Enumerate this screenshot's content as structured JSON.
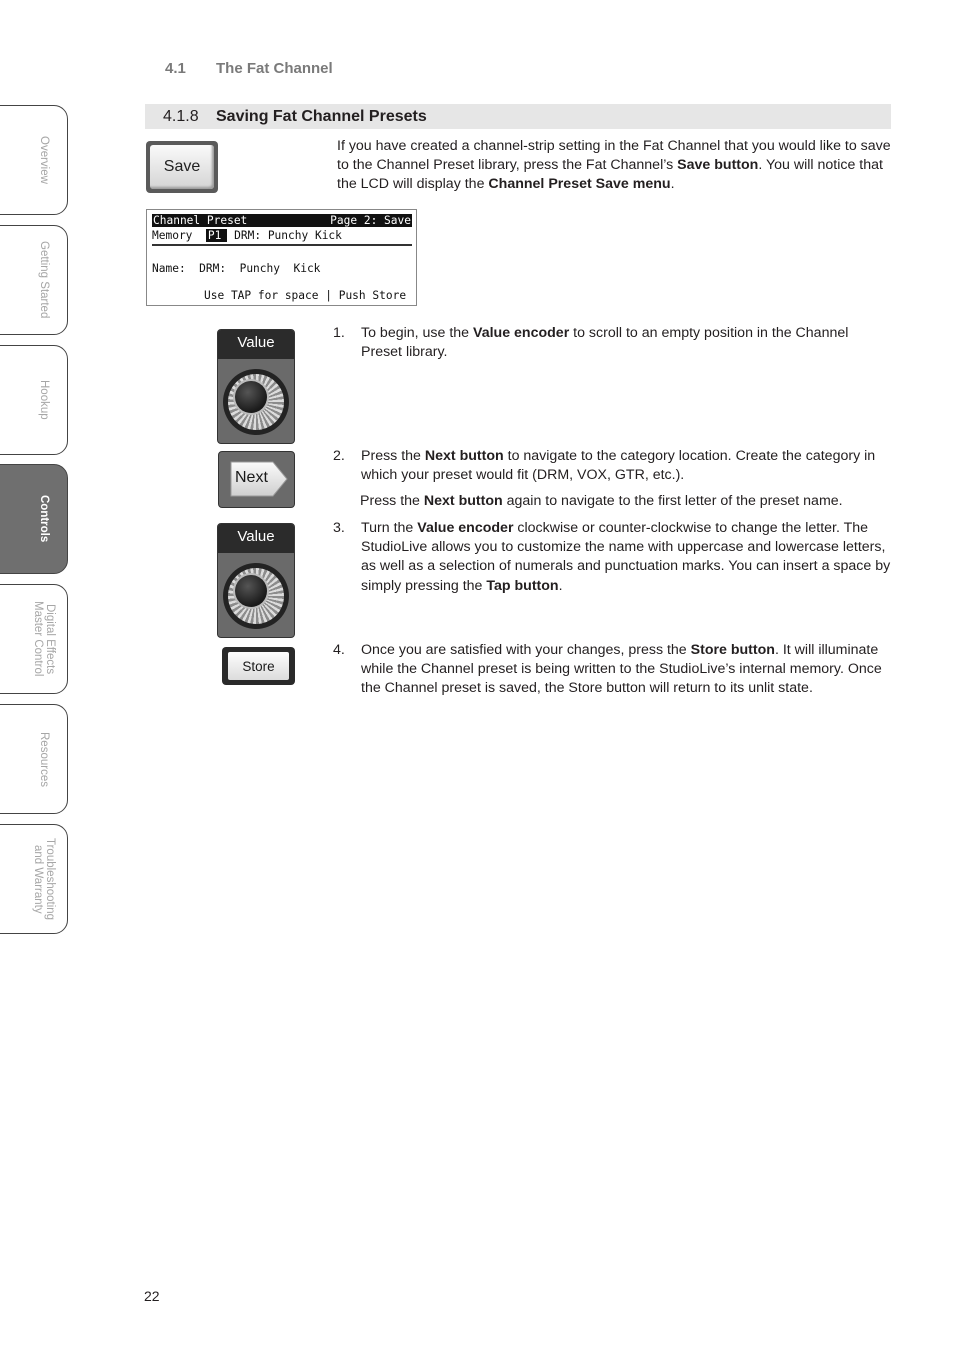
{
  "side_tabs": [
    {
      "label": "Overview",
      "active": false
    },
    {
      "label": "Getting Started",
      "active": false
    },
    {
      "label": "Hookup",
      "active": false
    },
    {
      "label": "Controls",
      "active": true
    },
    {
      "label": "Digital Effects\nMaster Control",
      "active": false
    },
    {
      "label": "Resources",
      "active": false
    },
    {
      "label": "Troubleshooting\nand Warranty",
      "active": false
    }
  ],
  "section": {
    "number": "4.1",
    "title": "The Fat Channel"
  },
  "subsection": {
    "number": "4.1.8",
    "title": "Saving Fat Channel Presets"
  },
  "save_button_label": "Save",
  "intro": {
    "part1": "If you have created a channel-strip setting in the Fat Channel that you would like to save to the Channel Preset library, press the Fat Channel’s ",
    "bold1": "Save button",
    "part2": ". You will notice that the LCD will display the ",
    "bold2": "Channel Preset Save menu",
    "part3": "."
  },
  "lcd": {
    "title_left": "Channel Preset",
    "title_right": "Page 2: Save",
    "memory_label": "Memory",
    "memory_slot": "P1",
    "memory_name": "DRM: Punchy Kick",
    "name_label": "Name:",
    "name_value": "DRM:  Punchy  Kick",
    "hint": "Use TAP for space | Push Store"
  },
  "controls": {
    "encoder_label": "Value",
    "next_label": "Next",
    "store_label": "Store"
  },
  "steps": [
    {
      "n": "1.",
      "pre": "To begin, use the ",
      "bold": "Value encoder",
      "post": " to scroll to an empty position in the Channel Preset library."
    },
    {
      "n": "2.",
      "pre": "Press the ",
      "bold": "Next button",
      "post": " to navigate to the category location. Create the category in which your preset would fit (DRM, VOX, GTR, etc.)."
    },
    {
      "n": "3.",
      "pre": "Turn the ",
      "bold": "Value encoder",
      "post": " clockwise or counter-clockwise to change the letter. The StudioLive allows you to customize the name with uppercase and lowercase letters, as well as a selection of numerals and punctuation marks. You can insert a space by simply pressing the ",
      "bold2": "Tap button",
      "post2": "."
    },
    {
      "n": "4.",
      "pre": "Once you are satisfied with your changes, press the ",
      "bold": "Store button",
      "post": ". It will illuminate while the Channel preset is being written to the StudioLive’s internal memory. Once the Channel preset is saved, the Store button will return to its unlit state."
    }
  ],
  "step2_note": {
    "pre": "Press the ",
    "bold": "Next button",
    "post": " again to navigate to the first letter of the preset name."
  },
  "page_number": "22"
}
